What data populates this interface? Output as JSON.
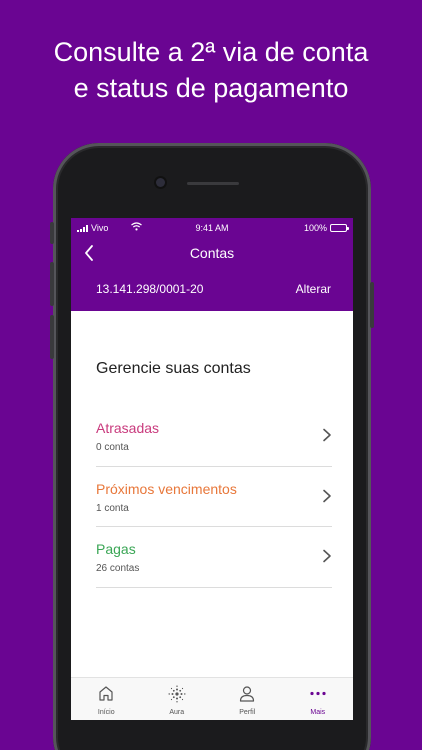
{
  "headline": {
    "line1": "Consulte a 2ª via de conta",
    "line2": "e status de pagamento"
  },
  "status_bar": {
    "carrier": "Vivo",
    "time": "9:41 AM",
    "battery": "100%"
  },
  "header": {
    "title": "Contas",
    "account_id": "13.141.298/0001-20",
    "change_label": "Alterar"
  },
  "main": {
    "section_title": "Gerencie suas contas",
    "items": [
      {
        "label": "Atrasadas",
        "count": "0 conta",
        "color": "#c93a7d"
      },
      {
        "label": "Próximos vencimentos",
        "count": "1 conta",
        "color": "#e8773a"
      },
      {
        "label": "Pagas",
        "count": "26 contas",
        "color": "#3aa655"
      }
    ]
  },
  "tabbar": {
    "tabs": [
      {
        "label": "Início",
        "icon": "home-icon"
      },
      {
        "label": "Aura",
        "icon": "aura-icon"
      },
      {
        "label": "Perfil",
        "icon": "profile-icon"
      },
      {
        "label": "Mais",
        "icon": "more-icon",
        "active": true
      }
    ]
  },
  "colors": {
    "brand": "#6a0592"
  }
}
